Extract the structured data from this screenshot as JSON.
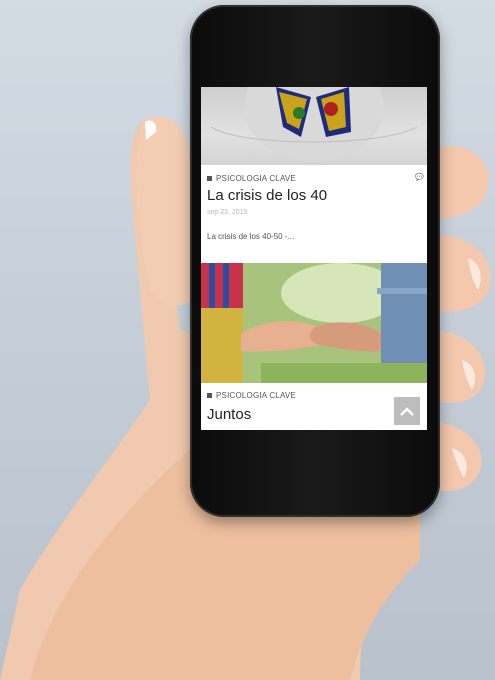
{
  "posts": [
    {
      "category": "PSICOLOGIA CLAVE",
      "title": "La crisis de los 40",
      "date": "sep 23, 2015",
      "excerpt": "La crisis de los 40-50 -..."
    },
    {
      "category": "PSICOLOGIA CLAVE",
      "title": "Juntos"
    }
  ],
  "icons": {
    "comment": "comment-icon",
    "scroll_top": "chevron-up-icon"
  },
  "colors": {
    "screen_bg": "#ffffff",
    "text_dark": "#222222",
    "category_text": "#555555",
    "scroll_button": "#bdbdbd"
  }
}
